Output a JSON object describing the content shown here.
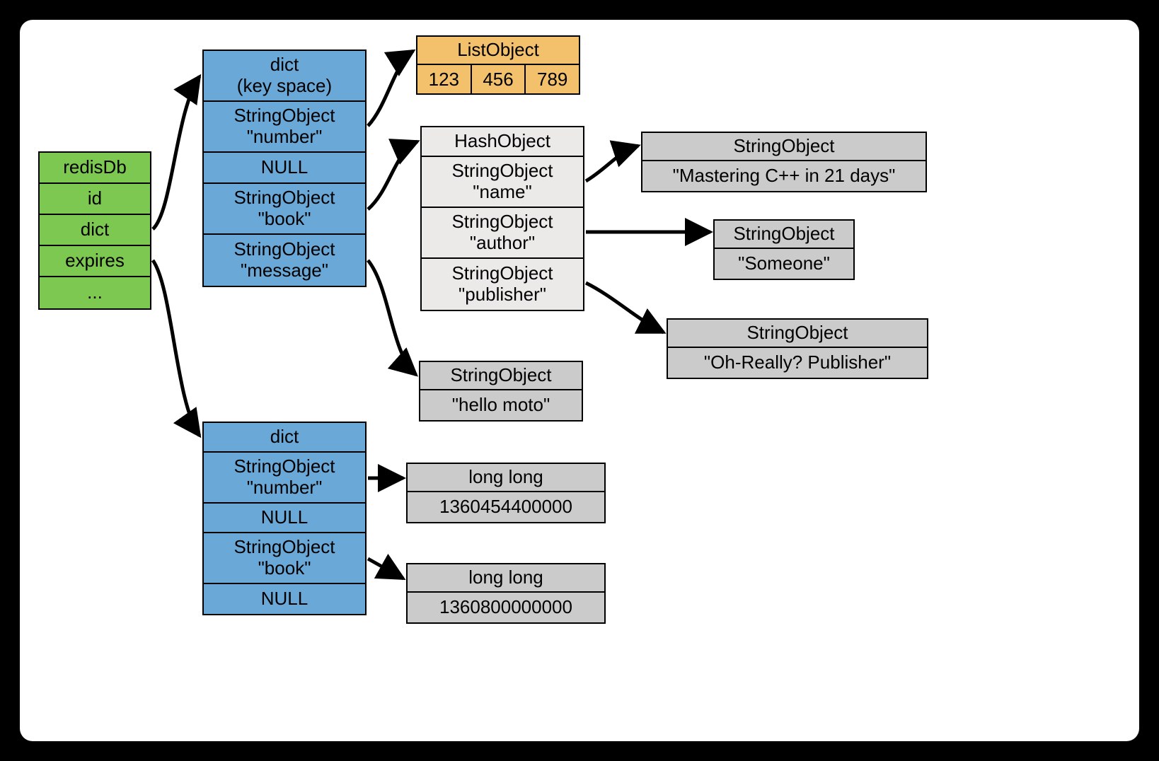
{
  "redisDb": {
    "title": "redisDb",
    "fields": [
      "id",
      "dict",
      "expires",
      "..."
    ]
  },
  "keyspace": {
    "title1": "dict",
    "title2": "(key space)",
    "entries": [
      {
        "type": "StringObject",
        "key": "\"number\""
      },
      {
        "null": "NULL"
      },
      {
        "type": "StringObject",
        "key": "\"book\""
      },
      {
        "type": "StringObject",
        "key": "\"message\""
      }
    ]
  },
  "listObject": {
    "title": "ListObject",
    "items": [
      "123",
      "456",
      "789"
    ]
  },
  "hashObject": {
    "title": "HashObject",
    "fields": [
      {
        "type": "StringObject",
        "key": "\"name\""
      },
      {
        "type": "StringObject",
        "key": "\"author\""
      },
      {
        "type": "StringObject",
        "key": "\"publisher\""
      }
    ]
  },
  "hashValues": {
    "name": {
      "type": "StringObject",
      "val": "\"Mastering C++ in 21 days\""
    },
    "author": {
      "type": "StringObject",
      "val": "\"Someone\""
    },
    "publisher": {
      "type": "StringObject",
      "val": "\"Oh-Really? Publisher\""
    }
  },
  "messageValue": {
    "type": "StringObject",
    "val": "\"hello moto\""
  },
  "expiresDict": {
    "title": "dict",
    "entries": [
      {
        "type": "StringObject",
        "key": "\"number\""
      },
      {
        "null": "NULL"
      },
      {
        "type": "StringObject",
        "key": "\"book\""
      },
      {
        "null2": "NULL"
      }
    ]
  },
  "expireValues": {
    "number": {
      "type": "long long",
      "val": "1360454400000"
    },
    "book": {
      "type": "long long",
      "val": "1360800000000"
    }
  }
}
